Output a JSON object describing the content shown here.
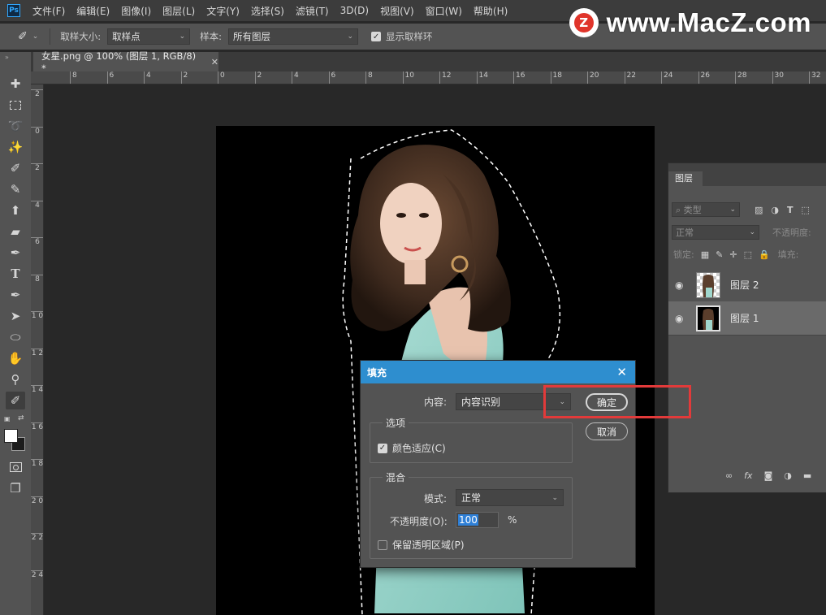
{
  "app": {
    "logo_text": "Ps"
  },
  "menu": [
    "文件(F)",
    "编辑(E)",
    "图像(I)",
    "图层(L)",
    "文字(Y)",
    "选择(S)",
    "滤镜(T)",
    "3D(D)",
    "视图(V)",
    "窗口(W)",
    "帮助(H)"
  ],
  "watermark": {
    "logo_letter": "Z",
    "text": "www.MacZ.com"
  },
  "options_bar": {
    "sample_size_label": "取样大小:",
    "sample_size_value": "取样点",
    "sample_label": "样本:",
    "sample_value": "所有图层",
    "show_ring_label": "显示取样环"
  },
  "document_tab": {
    "title": "女星.png @ 100% (图层 1, RGB/8) *"
  },
  "ruler": {
    "h_ticks": [
      "8",
      "6",
      "4",
      "2",
      "0",
      "2",
      "4",
      "6",
      "8",
      "10",
      "12",
      "14",
      "16",
      "18",
      "20",
      "22",
      "24",
      "26",
      "28",
      "30",
      "32"
    ],
    "v_ticks": [
      "2",
      "0",
      "2",
      "4",
      "6",
      "8",
      "1 0",
      "1 2",
      "1 4",
      "1 6",
      "1 8",
      "2 0",
      "2 2",
      "2 4"
    ]
  },
  "layers_panel": {
    "tab_label": "图层",
    "filter_placeholder": "类型",
    "blend_mode": "正常",
    "opacity_label": "不透明度:",
    "lock_label": "锁定:",
    "fill_label": "填充:",
    "layers": [
      {
        "name": "图层 2",
        "selected": false
      },
      {
        "name": "图层 1",
        "selected": true
      }
    ]
  },
  "fill_dialog": {
    "title": "填充",
    "content_label": "内容:",
    "content_value": "内容识别",
    "ok_label": "确定",
    "cancel_label": "取消",
    "options_group": "选项",
    "color_adapt_label": "颜色适应(C)",
    "color_adapt_checked": true,
    "blend_group": "混合",
    "mode_label": "模式:",
    "mode_value": "正常",
    "opacity_label": "不透明度(O):",
    "opacity_value": "100",
    "opacity_unit": "%",
    "preserve_label": "保留透明区域(P)",
    "preserve_checked": false
  },
  "colors": {
    "accent": "#2e8ecf",
    "highlight": "#e23a3a"
  }
}
